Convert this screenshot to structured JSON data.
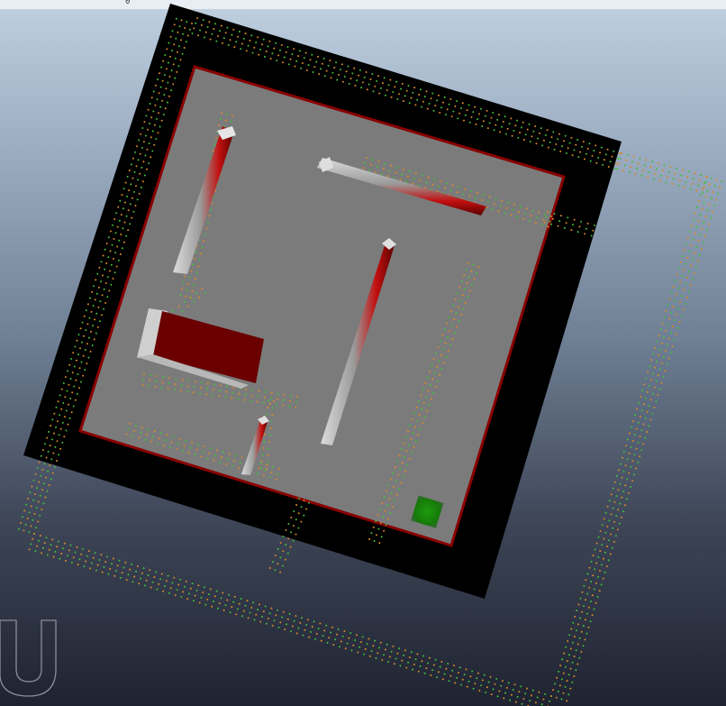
{
  "topbar": {
    "value": "0"
  },
  "scene": {
    "background": [
      "#bfd0e0",
      "#1f2331"
    ],
    "board_color": "#000000",
    "floor_color": "#7b7b7b",
    "wall_color": "#c00000",
    "block_color": "#6a0000",
    "goal_color": "#1a8a0a",
    "sensor_colors": [
      "#d98a2a",
      "#3fbf3f"
    ],
    "objects": [
      "board",
      "floor",
      "wall-left",
      "wall-top",
      "wall-center",
      "red-block",
      "small-wall",
      "goal"
    ],
    "watermark_icon": "u-shape-icon"
  }
}
